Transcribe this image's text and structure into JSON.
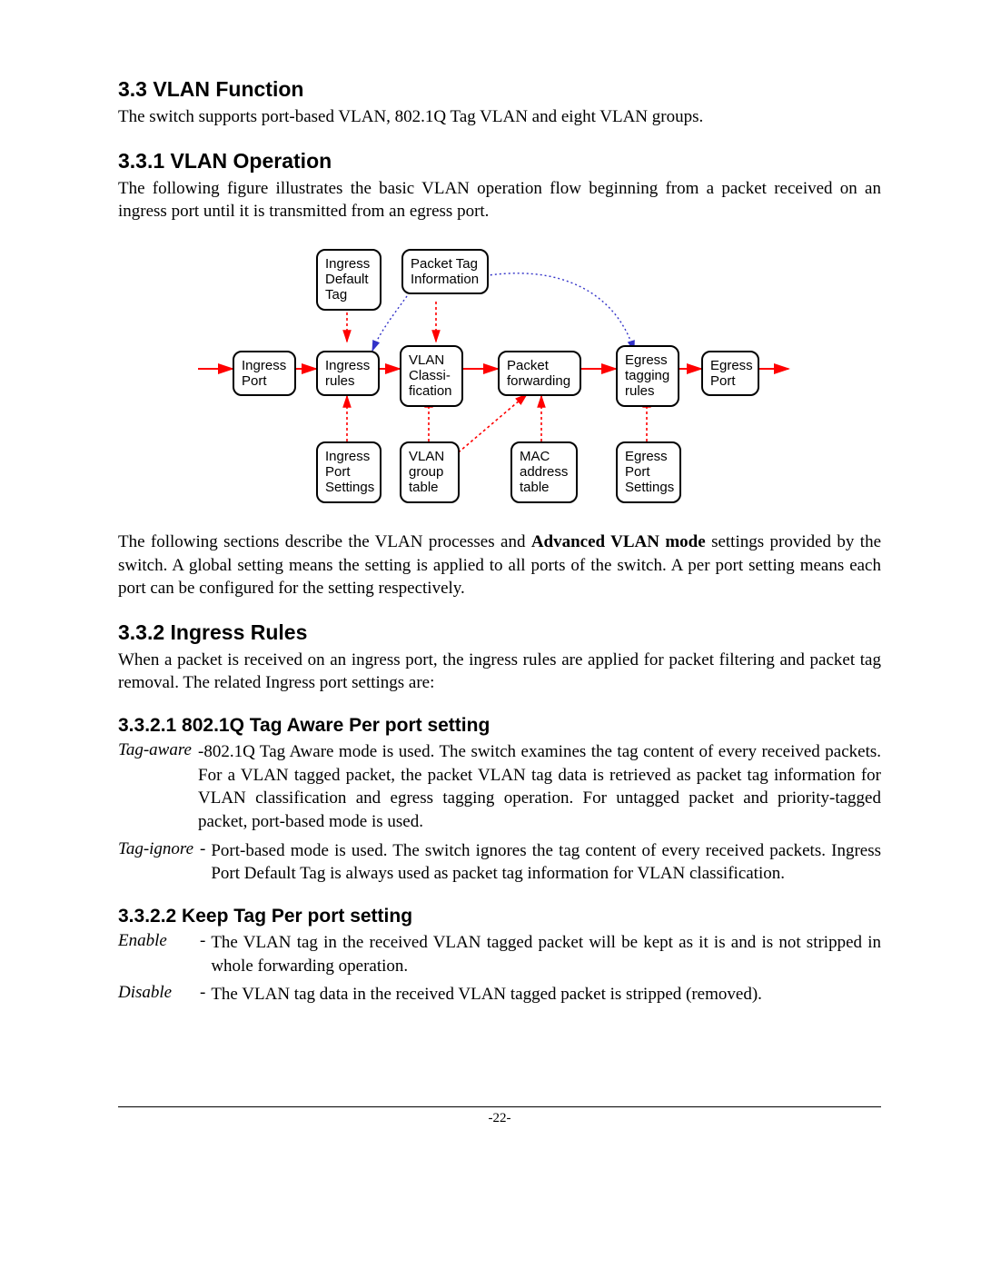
{
  "h33": "3.3 VLAN Function",
  "p33": "The switch supports port-based VLAN, 802.1Q Tag VLAN and eight VLAN groups.",
  "h331": "3.3.1 VLAN Operation",
  "p331": "The following figure illustrates the basic VLAN operation flow beginning from a packet received on an ingress port until it is transmitted from an egress port.",
  "p331b_a": "The following sections describe the VLAN processes and ",
  "p331b_bold": "Advanced VLAN mode",
  "p331b_c": " settings provided by the switch. A global setting means the setting is applied to all ports of the switch. A per port setting means each port can be configured for the setting respectively.",
  "h332": "3.3.2 Ingress Rules",
  "p332": "When a packet is received on an ingress port, the ingress rules are applied for packet filtering and packet tag removal. The related Ingress port settings are:",
  "h3321": "3.3.2.1 802.1Q Tag Aware Per port setting",
  "tagaware_term": "Tag-aware",
  "tagaware_body": "-802.1Q Tag Aware mode is used. The switch examines the tag content of every received packets. For a VLAN tagged packet, the packet VLAN tag data is retrieved as packet tag information for VLAN classification and egress tagging operation. For untagged packet and priority-tagged packet, port-based mode is used.",
  "tagignore_term": "Tag-ignore",
  "tagignore_body": "Port-based mode is used. The switch ignores the tag content of every received packets. Ingress Port Default Tag is always used as packet tag information for VLAN classification.",
  "h3322": "3.3.2.2 Keep Tag Per port setting",
  "enable_term": "Enable",
  "enable_body": "The VLAN tag in the received VLAN tagged packet will be kept as it is and is not stripped in whole forwarding operation.",
  "disable_term": "Disable",
  "disable_body": "The VLAN tag data in the received VLAN tagged packet is stripped (removed).",
  "page": "-22-",
  "boxes": {
    "b_ingress_default_tag": "Ingress\nDefault\nTag",
    "b_packet_tag_info": "Packet Tag\nInformation",
    "b_ingress_port": "Ingress\nPort",
    "b_ingress_rules": "Ingress\nrules",
    "b_vlan_class": "VLAN\nClassi-\nfication",
    "b_packet_fwd": "Packet\nforwarding",
    "b_egress_tag": "Egress\ntagging\nrules",
    "b_egress_port": "Egress\nPort",
    "b_ingress_port_set": "Ingress\nPort\nSettings",
    "b_vlan_group": "VLAN\ngroup\ntable",
    "b_mac_table": "MAC\naddress\ntable",
    "b_egress_port_set": "Egress\nPort\nSettings"
  }
}
